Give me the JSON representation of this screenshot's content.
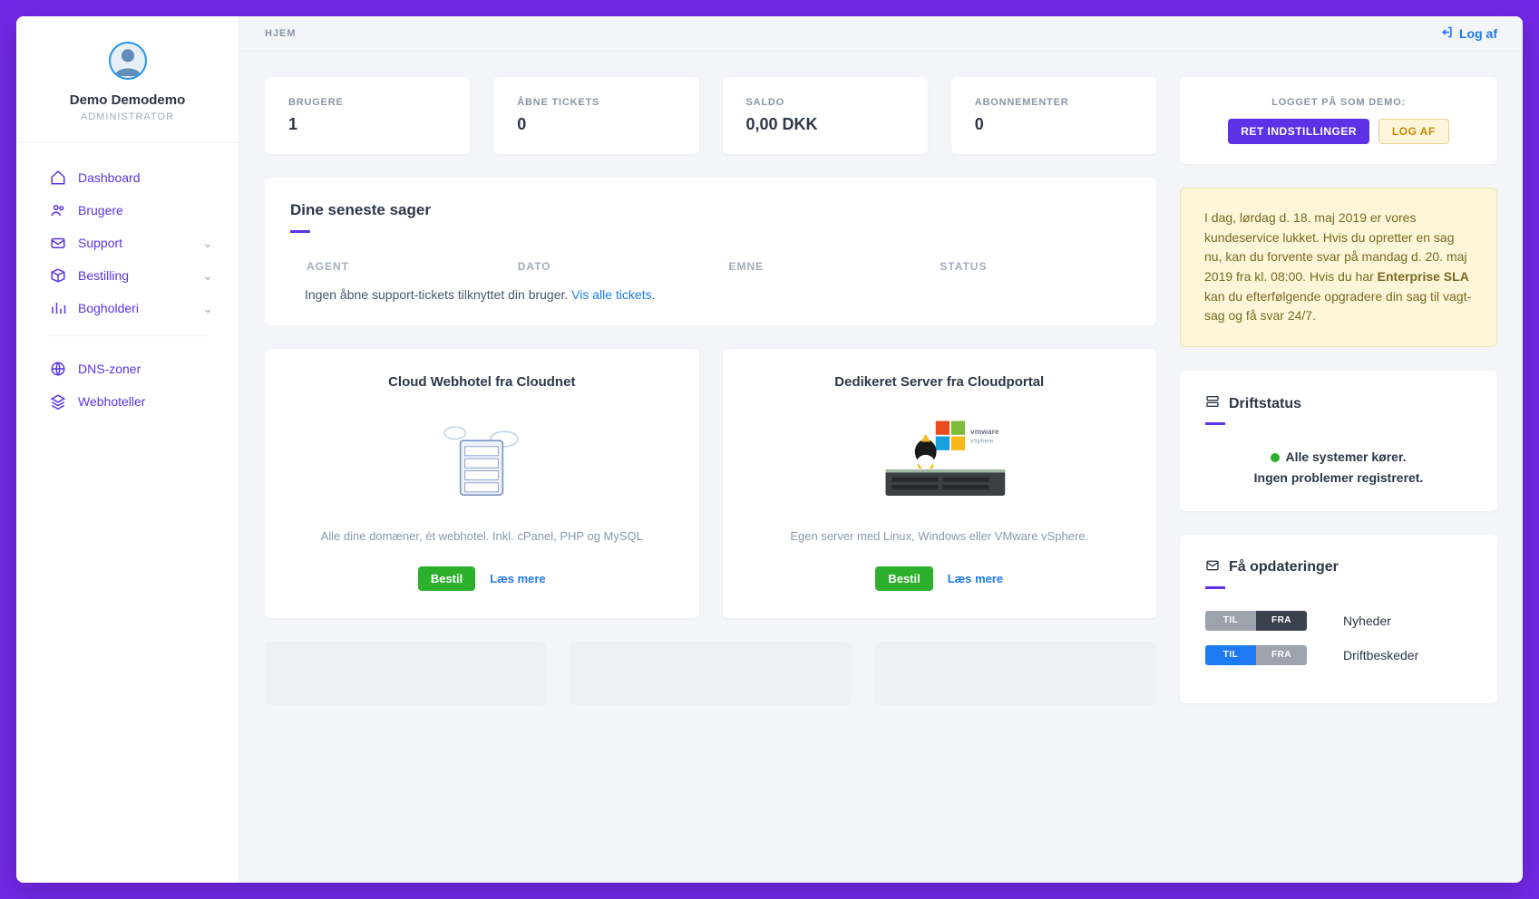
{
  "profile": {
    "name": "Demo Demodemo",
    "role": "ADMINISTRATOR"
  },
  "nav": {
    "dashboard": "Dashboard",
    "brugere": "Brugere",
    "support": "Support",
    "bestilling": "Bestilling",
    "bogholderi": "Bogholderi",
    "dnszoner": "DNS-zoner",
    "webhoteller": "Webhoteller"
  },
  "topbar": {
    "breadcrumb": "HJEM",
    "logout": "Log af"
  },
  "stats": [
    {
      "label": "BRUGERE",
      "value": "1"
    },
    {
      "label": "ÅBNE TICKETS",
      "value": "0"
    },
    {
      "label": "SALDO",
      "value": "0,00 DKK"
    },
    {
      "label": "ABONNEMENTER",
      "value": "0"
    }
  ],
  "recent": {
    "title": "Dine seneste sager",
    "cols": {
      "agent": "AGENT",
      "dato": "DATO",
      "emne": "EMNE",
      "status": "STATUS"
    },
    "empty_pre": "Ingen åbne support-tickets tilknyttet din bruger. ",
    "empty_link": "Vis alle tickets",
    "empty_post": "."
  },
  "products": [
    {
      "title": "Cloud Webhotel fra Cloudnet",
      "desc": "Alle dine domæner, ét webhotel. Inkl. cPanel, PHP og MySQL",
      "order": "Bestil",
      "more": "Læs mere"
    },
    {
      "title": "Dedikeret Server fra Cloudportal",
      "desc": "Egen server med Linux, Windows eller VMware vSphere.",
      "order": "Bestil",
      "more": "Læs mere"
    }
  ],
  "loginbox": {
    "label": "LOGGET PÅ SOM DEMO:",
    "edit": "RET INDSTILLINGER",
    "logout": "LOG AF"
  },
  "notice": {
    "text_pre": "I dag, lørdag d. 18. maj 2019 er vores kundeservice lukket. Hvis du opretter en sag nu, kan du forvente svar på mandag d. 20. maj 2019 fra kl. 08:00. Hvis du har ",
    "text_bold": "Enterprise SLA",
    "text_post": " kan du efterfølgende opgradere din sag til vagt-sag og få svar 24/7."
  },
  "drift": {
    "title": "Driftstatus",
    "ok": "Alle systemer kører.",
    "none": "Ingen problemer registreret."
  },
  "updates": {
    "title": "Få opdateringer",
    "on": "TIL",
    "off": "FRA",
    "news": "Nyheder",
    "ops": "Driftbeskeder"
  }
}
